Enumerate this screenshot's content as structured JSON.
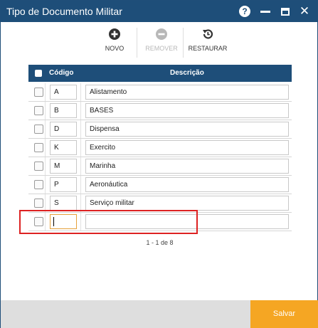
{
  "window": {
    "title": "Tipo de Documento Militar",
    "help_icon": "?"
  },
  "toolbar": {
    "novo": "NOVO",
    "remover": "REMOVER",
    "restaurar": "RESTAURAR"
  },
  "grid": {
    "headers": {
      "codigo": "Código",
      "descricao": "Descrição"
    },
    "rows": [
      {
        "codigo": "A",
        "descricao": "Alistamento"
      },
      {
        "codigo": "B",
        "descricao": "BASES"
      },
      {
        "codigo": "D",
        "descricao": "Dispensa"
      },
      {
        "codigo": "K",
        "descricao": "Exercito"
      },
      {
        "codigo": "M",
        "descricao": "Marinha"
      },
      {
        "codigo": "P",
        "descricao": "Aeronáutica"
      },
      {
        "codigo": "S",
        "descricao": "Serviço militar"
      },
      {
        "codigo": "",
        "descricao": ""
      }
    ]
  },
  "pager": {
    "text": "1 - 1 de 8"
  },
  "footer": {
    "save_label": "Salvar"
  },
  "colors": {
    "header_blue": "#1e4e79",
    "save_orange": "#f5a623",
    "highlight_red": "#dd2222"
  }
}
